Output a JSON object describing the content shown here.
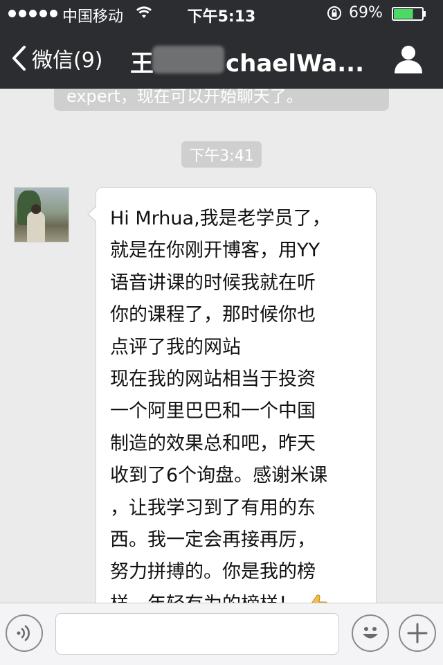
{
  "status_bar": {
    "carrier": "中国移动",
    "time": "下午5:13",
    "battery_percent": "69%",
    "battery_level": 0.69,
    "icons": [
      "signal-dots",
      "wifi-icon",
      "rotation-lock-icon",
      "battery-icon"
    ]
  },
  "nav": {
    "back_label": "微信(9)",
    "title_prefix": "王",
    "title_suffix": "chaelWa...",
    "icons": [
      "back-chevron-icon",
      "profile-icon"
    ]
  },
  "chat": {
    "system_notice": "expert，现在可以开始聊天了。",
    "timestamp": "下午3:41",
    "message": {
      "lines": [
        "Hi Mrhua,我是老学员了，",
        "就是在你刚开博客，用YY",
        "语音讲课的时候我就在听",
        "你的课程了，那时候你也",
        "点评了我的网站",
        "现在我的网站相当于投资",
        "一个阿里巴巴和一个中国",
        "制造的效果总和吧，昨天",
        "收到了6个询盘。感谢米课",
        "，让我学习到了有用的东",
        "西。我一定会再接再厉，",
        "努力拼搏的。你是我的榜",
        "样，年轻有为的榜样！"
      ],
      "emoji": "thumbs-up-icon"
    }
  },
  "input_bar": {
    "placeholder": "",
    "icons": [
      "voice-icon",
      "emoji-icon",
      "add-icon"
    ]
  },
  "colors": {
    "bar_background": "#2b2d30",
    "chat_background": "#ebebeb",
    "bubble_background": "#ffffff",
    "battery_fill": "#4cd964"
  }
}
